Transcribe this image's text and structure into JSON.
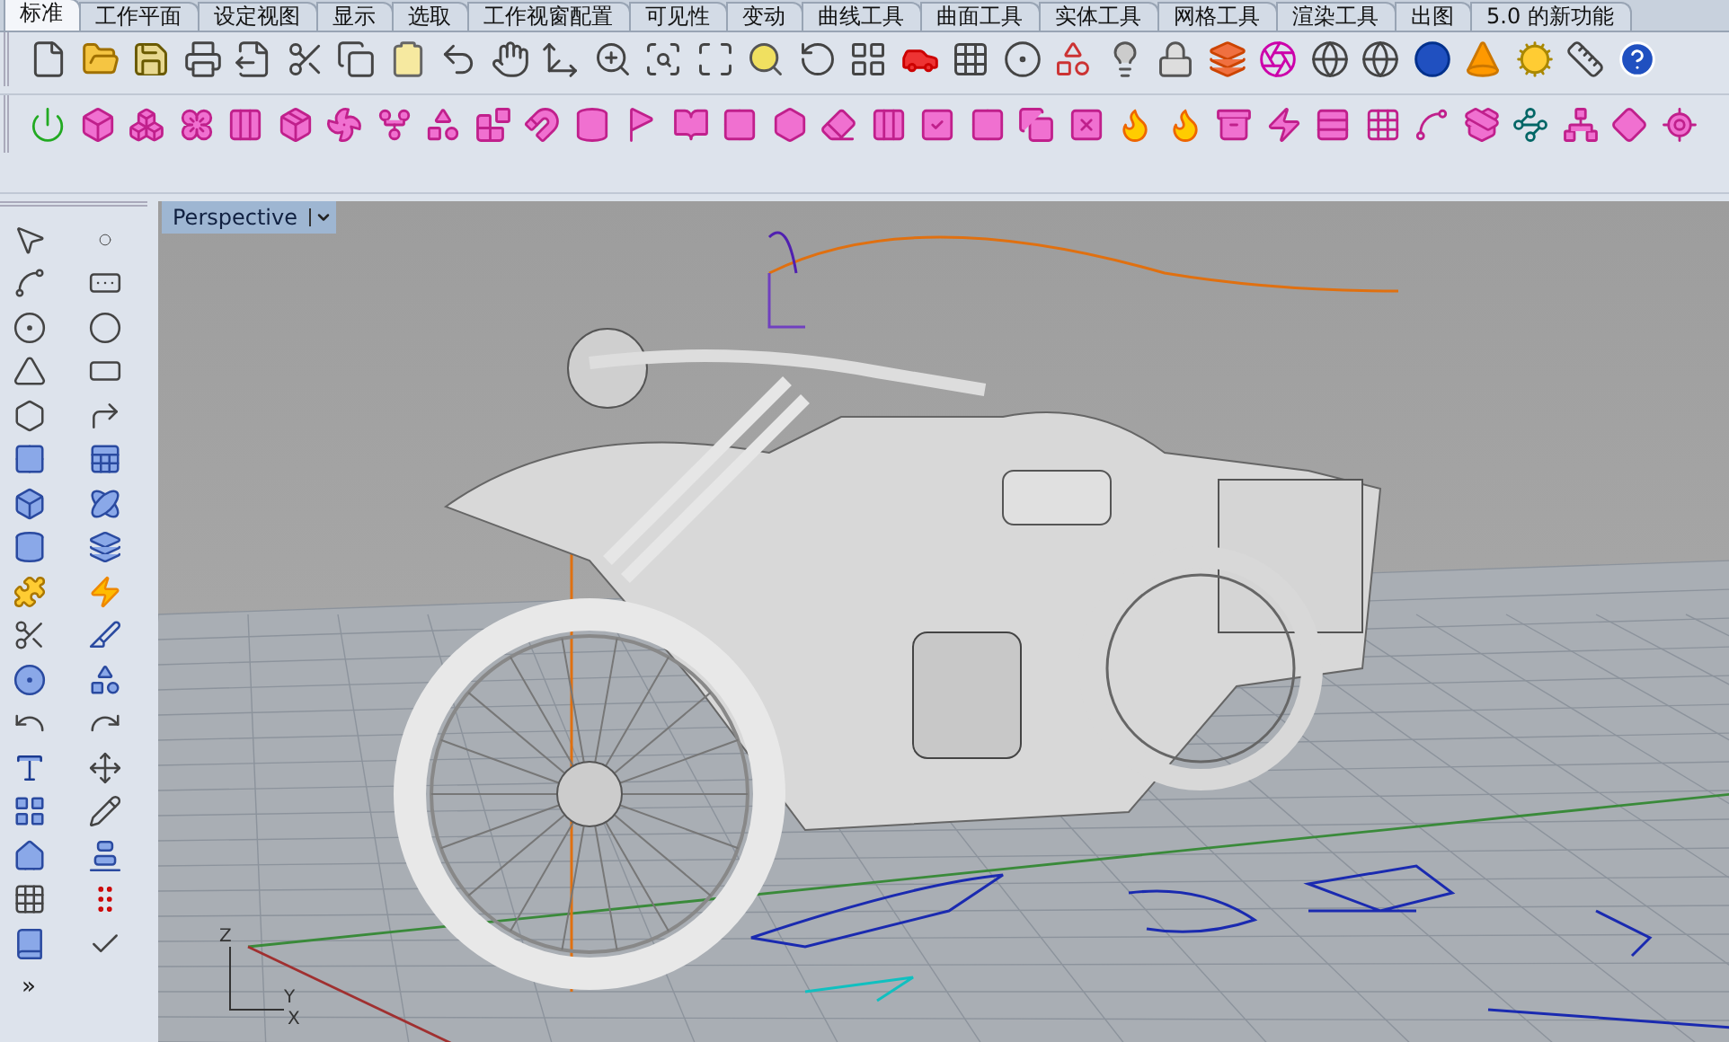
{
  "tabs": [
    {
      "label": "标准",
      "selected": true
    },
    {
      "label": "工作平面",
      "selected": false
    },
    {
      "label": "设定视图",
      "selected": false
    },
    {
      "label": "显示",
      "selected": false
    },
    {
      "label": "选取",
      "selected": false
    },
    {
      "label": "工作视窗配置",
      "selected": false
    },
    {
      "label": "可见性",
      "selected": false
    },
    {
      "label": "变动",
      "selected": false
    },
    {
      "label": "曲线工具",
      "selected": false
    },
    {
      "label": "曲面工具",
      "selected": false
    },
    {
      "label": "实体工具",
      "selected": false
    },
    {
      "label": "网格工具",
      "selected": false
    },
    {
      "label": "渲染工具",
      "selected": false
    },
    {
      "label": "出图",
      "selected": false
    },
    {
      "label": "5.0 的新功能",
      "selected": false
    }
  ],
  "side_toolbar": {
    "more": "»"
  },
  "viewport": {
    "title": "Perspective",
    "axes": {
      "z": "Z",
      "y": "Y",
      "x": "X"
    }
  }
}
